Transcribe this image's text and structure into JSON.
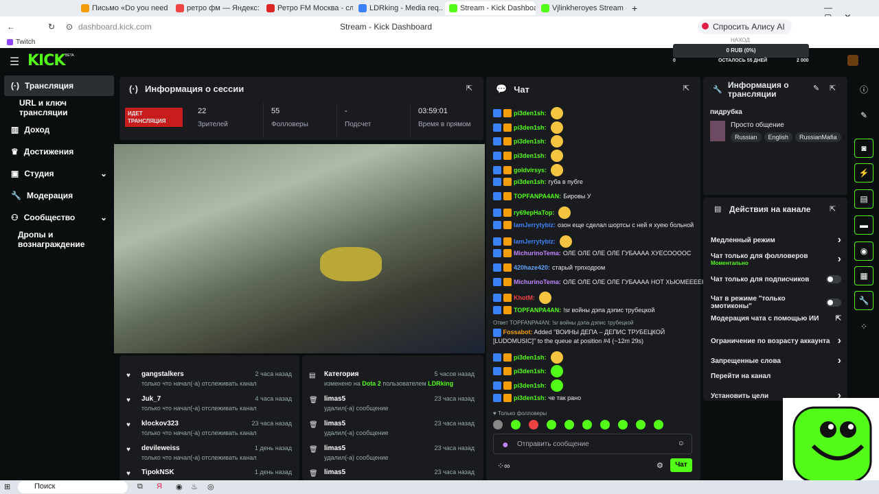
{
  "browser": {
    "tabs": [
      "Письмо «Do you need to ...",
      "ретро фм — Яндекс: наш...",
      "Ретро FM Москва - слуша...",
      "LDRking - Media req...",
      "Stream - Kick Dashboard",
      "Vjlinkheroyes Stream - Wa..."
    ],
    "address": "dashboard.kick.com",
    "page_title": "Stream - Kick Dashboard",
    "alice": "Спросить Алису AI",
    "bookmark": "Twitch"
  },
  "kick": {
    "logo": "KICK",
    "beta": "BETA",
    "balance_top": "НАХОД",
    "balance": "0 RUB (0%)",
    "balance_left": "0",
    "days_left": "ОСТАЛОСЬ 55 ДНЕЙ",
    "balance_right": "2 000"
  },
  "sidebar": {
    "items": [
      "Трансляция",
      "URL и ключ трансляции",
      "Доход",
      "Достижения",
      "Студия",
      "Модерация",
      "Сообщество",
      "Дропы и вознаграждение"
    ]
  },
  "session": {
    "title": "Информация о сессии",
    "live_badge": "ИДЕТ ТРАНСЛЯЦИЯ",
    "stats": [
      {
        "v": "22",
        "l": "Зрителей"
      },
      {
        "v": "55",
        "l": "Фолловеры"
      },
      {
        "v": "-",
        "l": "Подсчет"
      },
      {
        "v": "03:59:01",
        "l": "Время в прямом"
      }
    ]
  },
  "chat": {
    "title": "Чат",
    "followers_only": "Только фолловеры",
    "input_placeholder": "Отправить сообщение",
    "send": "Чат",
    "messages": [
      {
        "user": "pi3den1sh:",
        "text": "",
        "color": "#53fc18",
        "emote": true
      },
      {
        "user": "pi3den1sh:",
        "text": "",
        "color": "#53fc18",
        "emote": true
      },
      {
        "user": "pi3den1sh:",
        "text": "",
        "color": "#53fc18",
        "emote": true
      },
      {
        "user": "pi3den1sh:",
        "text": "",
        "color": "#53fc18",
        "emote": true
      },
      {
        "user": "goldvirsys:",
        "text": "",
        "color": "#53fc18",
        "emote": true
      },
      {
        "user": "pi3den1sh:",
        "text": "губа в пубге",
        "color": "#53fc18",
        "emote": false
      },
      {
        "user": "TOPFANPA4AN:",
        "text": "Бировы У",
        "color": "#53fc18",
        "emote": false
      },
      {
        "user": "ry69epHaTop:",
        "text": "",
        "color": "#53fc18",
        "emote": true
      },
      {
        "user": "IamJerrytybiz:",
        "text": "озон еще сделал шортсы с ней я хуею больной",
        "color": "#3b82f6",
        "emote": false
      },
      {
        "user": "IamJerrytybiz:",
        "text": "",
        "color": "#3b82f6",
        "emote": true
      },
      {
        "user": "MichurinoTema:",
        "text": "ОЛЕ ОЛЕ ОЛЕ ОЛЕ ГУБАААА ХУЕСОООOС",
        "color": "#c084fc",
        "emote": false
      },
      {
        "user": "420haze420:",
        "text": "старый трпходром",
        "color": "#60a5fa",
        "emote": false
      },
      {
        "user": "MichurinoTema:",
        "text": "ОЛЕ ОЛЕ ОЛЕ ОЛЕ ГУБАААА НОТ ХЬЮМЕЕЕЕН",
        "color": "#c084fc",
        "emote": false
      },
      {
        "user": "KhotM:",
        "text": "",
        "color": "#ef4444",
        "emote": true
      },
      {
        "user": "TOPFANPA4AN:",
        "text": "!sr войны дэпа дэпис трубецкой",
        "color": "#53fc18",
        "emote": false
      }
    ],
    "reply": "Ответ TOPFANPA4AN: !sr войны дэпа дэпис трубецкой",
    "bot_user": "Fossabot:",
    "bot_text": "Added \"ВОИНЫ ДЕПА – ДЕПИС ТРУБЕЦКОЙ [LUDOMUSIC]\" to the queue at position #4 (~12m 29s)",
    "messages2": [
      {
        "user": "pi3den1sh:",
        "text": "",
        "emote": true
      },
      {
        "user": "pi3den1sh:",
        "text": "",
        "emote": true
      },
      {
        "user": "pi3den1sh:",
        "text": "",
        "emote": true
      },
      {
        "user": "pi3den1sh:",
        "text": "че так рано",
        "emote": false
      }
    ]
  },
  "stream_info": {
    "title": "Информация о трансляции",
    "stream_title": "пидрубка",
    "category": "Просто общение",
    "tags": [
      "Russian",
      "English",
      "RussianMafia"
    ]
  },
  "actions": {
    "title": "Действия на канале",
    "items": [
      {
        "label": "Медленный режим",
        "ctl": "arrow",
        "sub": ""
      },
      {
        "label": "Чат только для фолловеров",
        "ctl": "arrow",
        "sub": "Моментально"
      },
      {
        "label": "Чат только для подписчиков",
        "ctl": "toggle",
        "sub": ""
      },
      {
        "label": "Чат в режиме \"только эмотиконы\"",
        "ctl": "toggle",
        "sub": ""
      },
      {
        "label": "Модерация чата с помощью ИИ",
        "ctl": "ext",
        "sub": ""
      },
      {
        "label": "Ограничение по возрасту аккаунта",
        "ctl": "arrow",
        "sub": ""
      },
      {
        "label": "Запрещенные слова",
        "ctl": "arrow",
        "sub": ""
      },
      {
        "label": "Перейти на канал",
        "ctl": "none",
        "sub": ""
      },
      {
        "label": "Установить цели",
        "ctl": "arrow",
        "sub": ""
      }
    ]
  },
  "followers": [
    {
      "n": "gangstalkers",
      "s": "только что начал(-а) отслеживать канал",
      "t": "2 часа назад"
    },
    {
      "n": "Juk_7",
      "s": "только что начал(-а) отслеживать канал",
      "t": "4 часа назад"
    },
    {
      "n": "klockov323",
      "s": "только что начал(-а) отслеживать канал",
      "t": "23 часа назад"
    },
    {
      "n": "devileweiss",
      "s": "только что начал(-а) отслеживать канал",
      "t": "1 день назад"
    },
    {
      "n": "TipokNSK",
      "s": "",
      "t": "1 день назад"
    }
  ],
  "modlog": [
    {
      "n": "Категория",
      "s": "изменено на",
      "s2": "Dota 2",
      "s3": "пользователем",
      "s4": "LDRking",
      "t": "5 часов назад"
    },
    {
      "n": "limas5",
      "s": "удалил(-а) сообщение",
      "t": "23 часа назад"
    },
    {
      "n": "limas5",
      "s": "удалил(-а) сообщение",
      "t": "23 часа назад"
    },
    {
      "n": "limas5",
      "s": "удалил(-а) сообщение",
      "t": "23 часа назад"
    },
    {
      "n": "limas5",
      "s": "",
      "t": "23 часа назад"
    }
  ],
  "taskbar": {
    "search": "Поиск"
  }
}
